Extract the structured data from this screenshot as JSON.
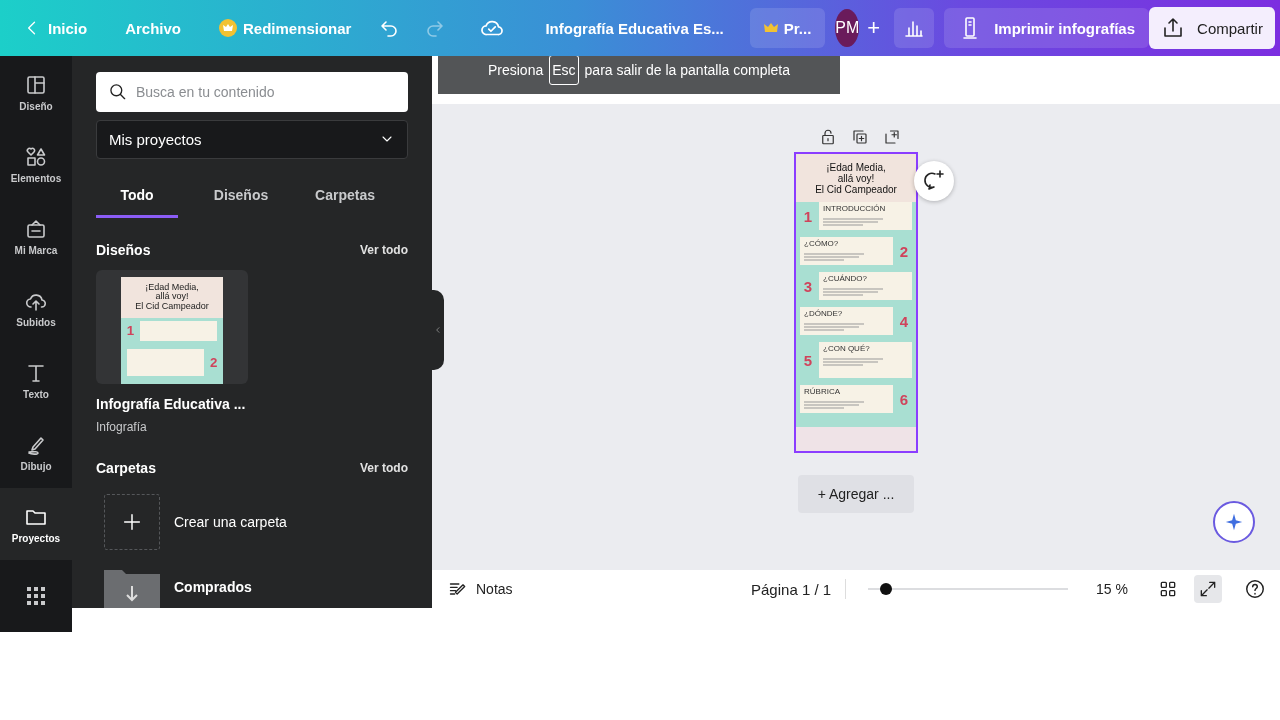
{
  "topbar": {
    "back": "Inicio",
    "file": "Archivo",
    "resize": "Redimensionar",
    "doc_title": "Infografía Educativa Es...",
    "pro": "Pr...",
    "avatar": "PM",
    "add": "+",
    "print": "Imprimir infografías",
    "share": "Compartir"
  },
  "fullscreen_notice": {
    "before": "Presiona",
    "key": "Esc",
    "after": "para salir de la pantalla completa"
  },
  "rail": [
    {
      "label": "Diseño",
      "selected": false
    },
    {
      "label": "Elementos",
      "selected": false
    },
    {
      "label": "Mi Marca",
      "selected": false
    },
    {
      "label": "Subidos",
      "selected": false
    },
    {
      "label": "Texto",
      "selected": false
    },
    {
      "label": "Dibujo",
      "selected": false
    },
    {
      "label": "Proyectos",
      "selected": true
    },
    {
      "selected": false
    }
  ],
  "panel": {
    "search": {
      "placeholder": "Busca en tu contenido"
    },
    "dropdown": "Mis proyectos",
    "tabs": [
      {
        "label": "Todo",
        "selected": true
      },
      {
        "label": "Diseños",
        "selected": false
      },
      {
        "label": "Carpetas",
        "selected": false
      }
    ],
    "designs": {
      "title": "Diseños",
      "see_all": "Ver todo",
      "items": [
        {
          "name": "Infografía Educativa ...",
          "type": "Infografía",
          "thumbnail": {
            "title_lines": [
              "¡Edad Media,",
              "allá voy!",
              "El Cid Campeador"
            ],
            "numbers": [
              "1",
              "2"
            ]
          }
        }
      ]
    },
    "folders": {
      "title": "Carpetas",
      "see_all": "Ver todo",
      "items": [
        {
          "kind": "create",
          "label": "Crear una carpeta"
        },
        {
          "kind": "folder",
          "label": "Comprados"
        }
      ]
    }
  },
  "design_page": {
    "title_lines": [
      "¡Edad Media,",
      "allá voy!",
      "El Cid Campeador"
    ],
    "sections": [
      {
        "number": "1",
        "heading": "INTRODUCCIÓN"
      },
      {
        "number": "2",
        "heading": "¿CÓMO?"
      },
      {
        "number": "3",
        "heading": "¿CUÁNDO?"
      },
      {
        "number": "4",
        "heading": "¿DÓNDE?"
      },
      {
        "number": "5",
        "heading": "¿CON QUÉ?"
      },
      {
        "number": "6",
        "heading": "RÚBRICA"
      }
    ]
  },
  "add_page": "+ Agregar ...",
  "bottom": {
    "notes": "Notas",
    "page": "Página 1 / 1",
    "zoom": {
      "level": 0.09
    },
    "zoom_reading": "15 %"
  }
}
